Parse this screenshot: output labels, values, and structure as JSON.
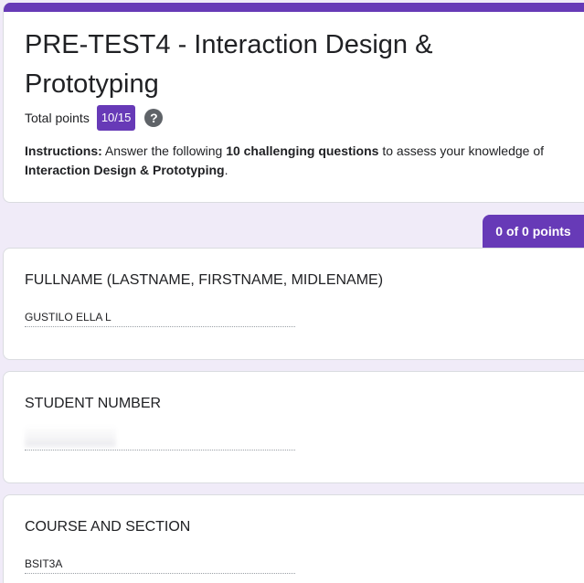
{
  "header": {
    "title": "PRE-TEST4 - Interaction Design & Prototyping",
    "total_points_label": "Total points",
    "points_score": "10/15",
    "help_icon_glyph": "?",
    "instructions": {
      "lead": "Instructions:",
      "text_1": " Answer the following ",
      "bold_1": "10 challenging questions",
      "text_2": " to assess your knowledge of ",
      "bold_2": "Interaction Design & Prototyping",
      "text_3": "."
    }
  },
  "section_score": "0 of 0 points",
  "questions": [
    {
      "title": "FULLNAME (LASTNAME, FIRSTNAME, MIDLENAME)",
      "answer": "GUSTILO ELLA L"
    },
    {
      "title": "STUDENT NUMBER",
      "answer": ""
    },
    {
      "title": "COURSE AND SECTION",
      "answer": "BSIT3A"
    }
  ],
  "colors": {
    "accent": "#673ab7",
    "background": "#f0ebf8",
    "help_icon": "#5f6368"
  }
}
